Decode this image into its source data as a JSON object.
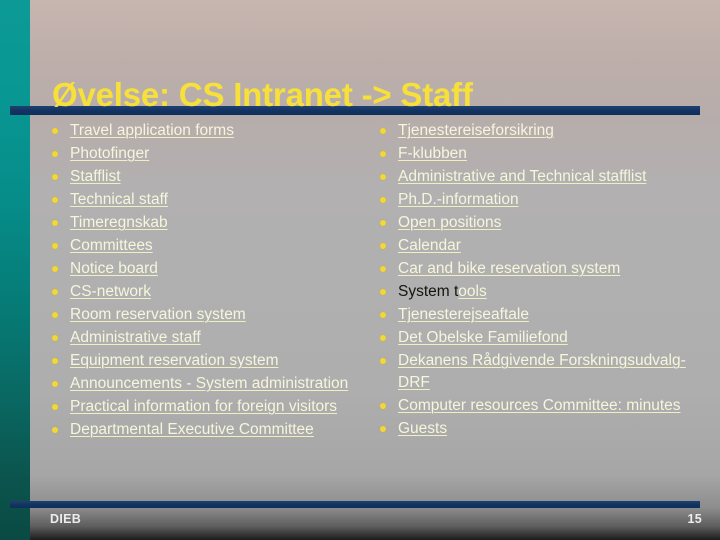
{
  "slide": {
    "title": "Øvelse: CS Intranet -> Staff",
    "accent_title_color": "#f7e03a",
    "link_text_color": "#f6f6dd",
    "bullet_color": "#f0d83c",
    "rule_color": "#123362",
    "sidebar_top_color": "#0d9a96",
    "sidebar_bottom_color": "#0a4a43"
  },
  "left_column": {
    "items": [
      {
        "label": "Travel application forms"
      },
      {
        "label": "Photofinger"
      },
      {
        "label": "Stafflist"
      },
      {
        "label": "Technical staff"
      },
      {
        "label": "Timeregnskab"
      },
      {
        "label": "Committees"
      },
      {
        "label": "Notice board"
      },
      {
        "label": "CS-network"
      },
      {
        "label": "Room reservation system"
      },
      {
        "label": "Administrative staff"
      },
      {
        "label": "Equipment reservation system"
      },
      {
        "label": "Announcements - System administration"
      },
      {
        "label": "Practical information for foreign visitors"
      },
      {
        "label": "Departmental Executive Committee"
      }
    ]
  },
  "right_column": {
    "items": [
      {
        "label": "Tjenestereiseforsikring"
      },
      {
        "label": "F-klubben"
      },
      {
        "label": "Administrative and Technical stafflist"
      },
      {
        "label": "Ph.D.-information"
      },
      {
        "label": "Open positions"
      },
      {
        "label": "Calendar"
      },
      {
        "label": "Car and bike reservation system"
      },
      {
        "label": "System tools",
        "dark_prefix": "System t",
        "link_suffix": "ools"
      },
      {
        "label": "Tjenesterejseaftale"
      },
      {
        "label": "Det Obelske Familiefond"
      },
      {
        "label": "Dekanens Rådgivende Forskningsudvalg-DRF"
      },
      {
        "label": "Computer resources Committee: minutes"
      },
      {
        "label": "Guests"
      }
    ]
  },
  "footer": {
    "author": "DIEB",
    "page_number": "15"
  }
}
